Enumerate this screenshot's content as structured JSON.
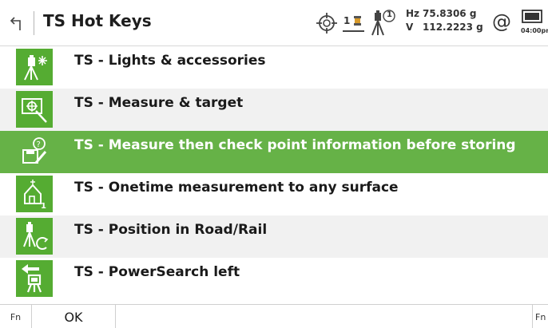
{
  "header": {
    "title": "TS Hot Keys",
    "back_icon": "back-arrow-icon",
    "status": {
      "prism_number": "1",
      "instrument_number": "1",
      "hz_prefix": "Hz",
      "hz_value": "75.8306 g",
      "v_prefix": "V",
      "v_value": "112.2223 g",
      "connection_symbol": "@",
      "time": "04:00pm"
    }
  },
  "list": {
    "items": [
      {
        "label": "TS - Lights & accessories",
        "icon": "lights-accessories-icon",
        "selected": false
      },
      {
        "label": "TS - Measure & target",
        "icon": "measure-target-icon",
        "selected": false
      },
      {
        "label": "TS - Measure then check point information before storing",
        "icon": "check-point-icon",
        "selected": true
      },
      {
        "label": "TS - Onetime measurement to any surface",
        "icon": "onetime-measurement-icon",
        "selected": false
      },
      {
        "label": "TS - Position in Road/Rail",
        "icon": "road-rail-icon",
        "selected": false
      },
      {
        "label": "TS - PowerSearch left",
        "icon": "powersearch-icon",
        "selected": false
      }
    ]
  },
  "bottombar": {
    "fn_left": "Fn",
    "ok_label": "OK",
    "fn_right": "Fn"
  },
  "colors": {
    "accent_green": "#66b247",
    "icon_green": "#55ac32",
    "alt_row": "#f1f1f1"
  }
}
